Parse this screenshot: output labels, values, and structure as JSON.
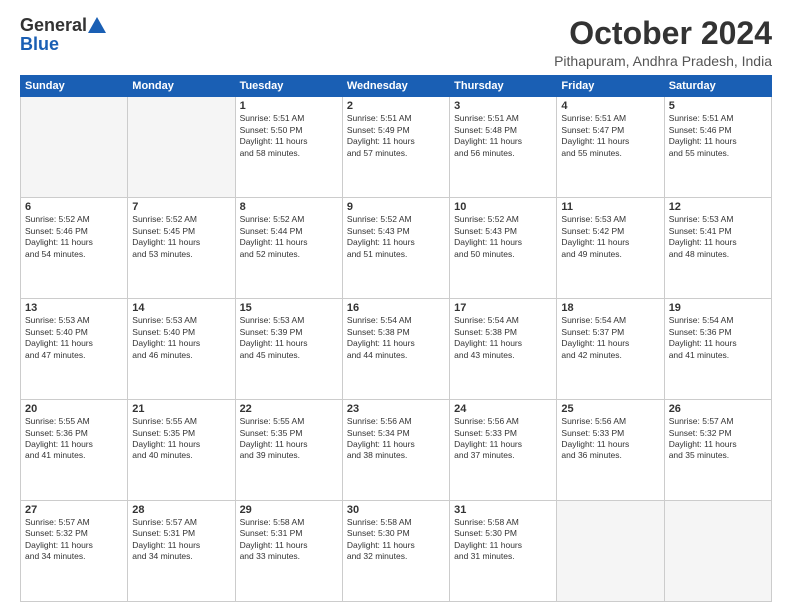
{
  "logo": {
    "general": "General",
    "blue": "Blue"
  },
  "header": {
    "month": "October 2024",
    "location": "Pithapuram, Andhra Pradesh, India"
  },
  "weekdays": [
    "Sunday",
    "Monday",
    "Tuesday",
    "Wednesday",
    "Thursday",
    "Friday",
    "Saturday"
  ],
  "weeks": [
    [
      {
        "day": "",
        "empty": true
      },
      {
        "day": "",
        "empty": true
      },
      {
        "day": "1",
        "sunrise": "5:51 AM",
        "sunset": "5:50 PM",
        "daylight": "11 hours and 58 minutes."
      },
      {
        "day": "2",
        "sunrise": "5:51 AM",
        "sunset": "5:49 PM",
        "daylight": "11 hours and 57 minutes."
      },
      {
        "day": "3",
        "sunrise": "5:51 AM",
        "sunset": "5:48 PM",
        "daylight": "11 hours and 56 minutes."
      },
      {
        "day": "4",
        "sunrise": "5:51 AM",
        "sunset": "5:47 PM",
        "daylight": "11 hours and 55 minutes."
      },
      {
        "day": "5",
        "sunrise": "5:51 AM",
        "sunset": "5:46 PM",
        "daylight": "11 hours and 55 minutes."
      }
    ],
    [
      {
        "day": "6",
        "sunrise": "5:52 AM",
        "sunset": "5:46 PM",
        "daylight": "11 hours and 54 minutes."
      },
      {
        "day": "7",
        "sunrise": "5:52 AM",
        "sunset": "5:45 PM",
        "daylight": "11 hours and 53 minutes."
      },
      {
        "day": "8",
        "sunrise": "5:52 AM",
        "sunset": "5:44 PM",
        "daylight": "11 hours and 52 minutes."
      },
      {
        "day": "9",
        "sunrise": "5:52 AM",
        "sunset": "5:43 PM",
        "daylight": "11 hours and 51 minutes."
      },
      {
        "day": "10",
        "sunrise": "5:52 AM",
        "sunset": "5:43 PM",
        "daylight": "11 hours and 50 minutes."
      },
      {
        "day": "11",
        "sunrise": "5:53 AM",
        "sunset": "5:42 PM",
        "daylight": "11 hours and 49 minutes."
      },
      {
        "day": "12",
        "sunrise": "5:53 AM",
        "sunset": "5:41 PM",
        "daylight": "11 hours and 48 minutes."
      }
    ],
    [
      {
        "day": "13",
        "sunrise": "5:53 AM",
        "sunset": "5:40 PM",
        "daylight": "11 hours and 47 minutes."
      },
      {
        "day": "14",
        "sunrise": "5:53 AM",
        "sunset": "5:40 PM",
        "daylight": "11 hours and 46 minutes."
      },
      {
        "day": "15",
        "sunrise": "5:53 AM",
        "sunset": "5:39 PM",
        "daylight": "11 hours and 45 minutes."
      },
      {
        "day": "16",
        "sunrise": "5:54 AM",
        "sunset": "5:38 PM",
        "daylight": "11 hours and 44 minutes."
      },
      {
        "day": "17",
        "sunrise": "5:54 AM",
        "sunset": "5:38 PM",
        "daylight": "11 hours and 43 minutes."
      },
      {
        "day": "18",
        "sunrise": "5:54 AM",
        "sunset": "5:37 PM",
        "daylight": "11 hours and 42 minutes."
      },
      {
        "day": "19",
        "sunrise": "5:54 AM",
        "sunset": "5:36 PM",
        "daylight": "11 hours and 41 minutes."
      }
    ],
    [
      {
        "day": "20",
        "sunrise": "5:55 AM",
        "sunset": "5:36 PM",
        "daylight": "11 hours and 41 minutes."
      },
      {
        "day": "21",
        "sunrise": "5:55 AM",
        "sunset": "5:35 PM",
        "daylight": "11 hours and 40 minutes."
      },
      {
        "day": "22",
        "sunrise": "5:55 AM",
        "sunset": "5:35 PM",
        "daylight": "11 hours and 39 minutes."
      },
      {
        "day": "23",
        "sunrise": "5:56 AM",
        "sunset": "5:34 PM",
        "daylight": "11 hours and 38 minutes."
      },
      {
        "day": "24",
        "sunrise": "5:56 AM",
        "sunset": "5:33 PM",
        "daylight": "11 hours and 37 minutes."
      },
      {
        "day": "25",
        "sunrise": "5:56 AM",
        "sunset": "5:33 PM",
        "daylight": "11 hours and 36 minutes."
      },
      {
        "day": "26",
        "sunrise": "5:57 AM",
        "sunset": "5:32 PM",
        "daylight": "11 hours and 35 minutes."
      }
    ],
    [
      {
        "day": "27",
        "sunrise": "5:57 AM",
        "sunset": "5:32 PM",
        "daylight": "11 hours and 34 minutes."
      },
      {
        "day": "28",
        "sunrise": "5:57 AM",
        "sunset": "5:31 PM",
        "daylight": "11 hours and 34 minutes."
      },
      {
        "day": "29",
        "sunrise": "5:58 AM",
        "sunset": "5:31 PM",
        "daylight": "11 hours and 33 minutes."
      },
      {
        "day": "30",
        "sunrise": "5:58 AM",
        "sunset": "5:30 PM",
        "daylight": "11 hours and 32 minutes."
      },
      {
        "day": "31",
        "sunrise": "5:58 AM",
        "sunset": "5:30 PM",
        "daylight": "11 hours and 31 minutes."
      },
      {
        "day": "",
        "empty": true
      },
      {
        "day": "",
        "empty": true
      }
    ]
  ],
  "labels": {
    "sunrise": "Sunrise:",
    "sunset": "Sunset:",
    "daylight": "Daylight:"
  }
}
